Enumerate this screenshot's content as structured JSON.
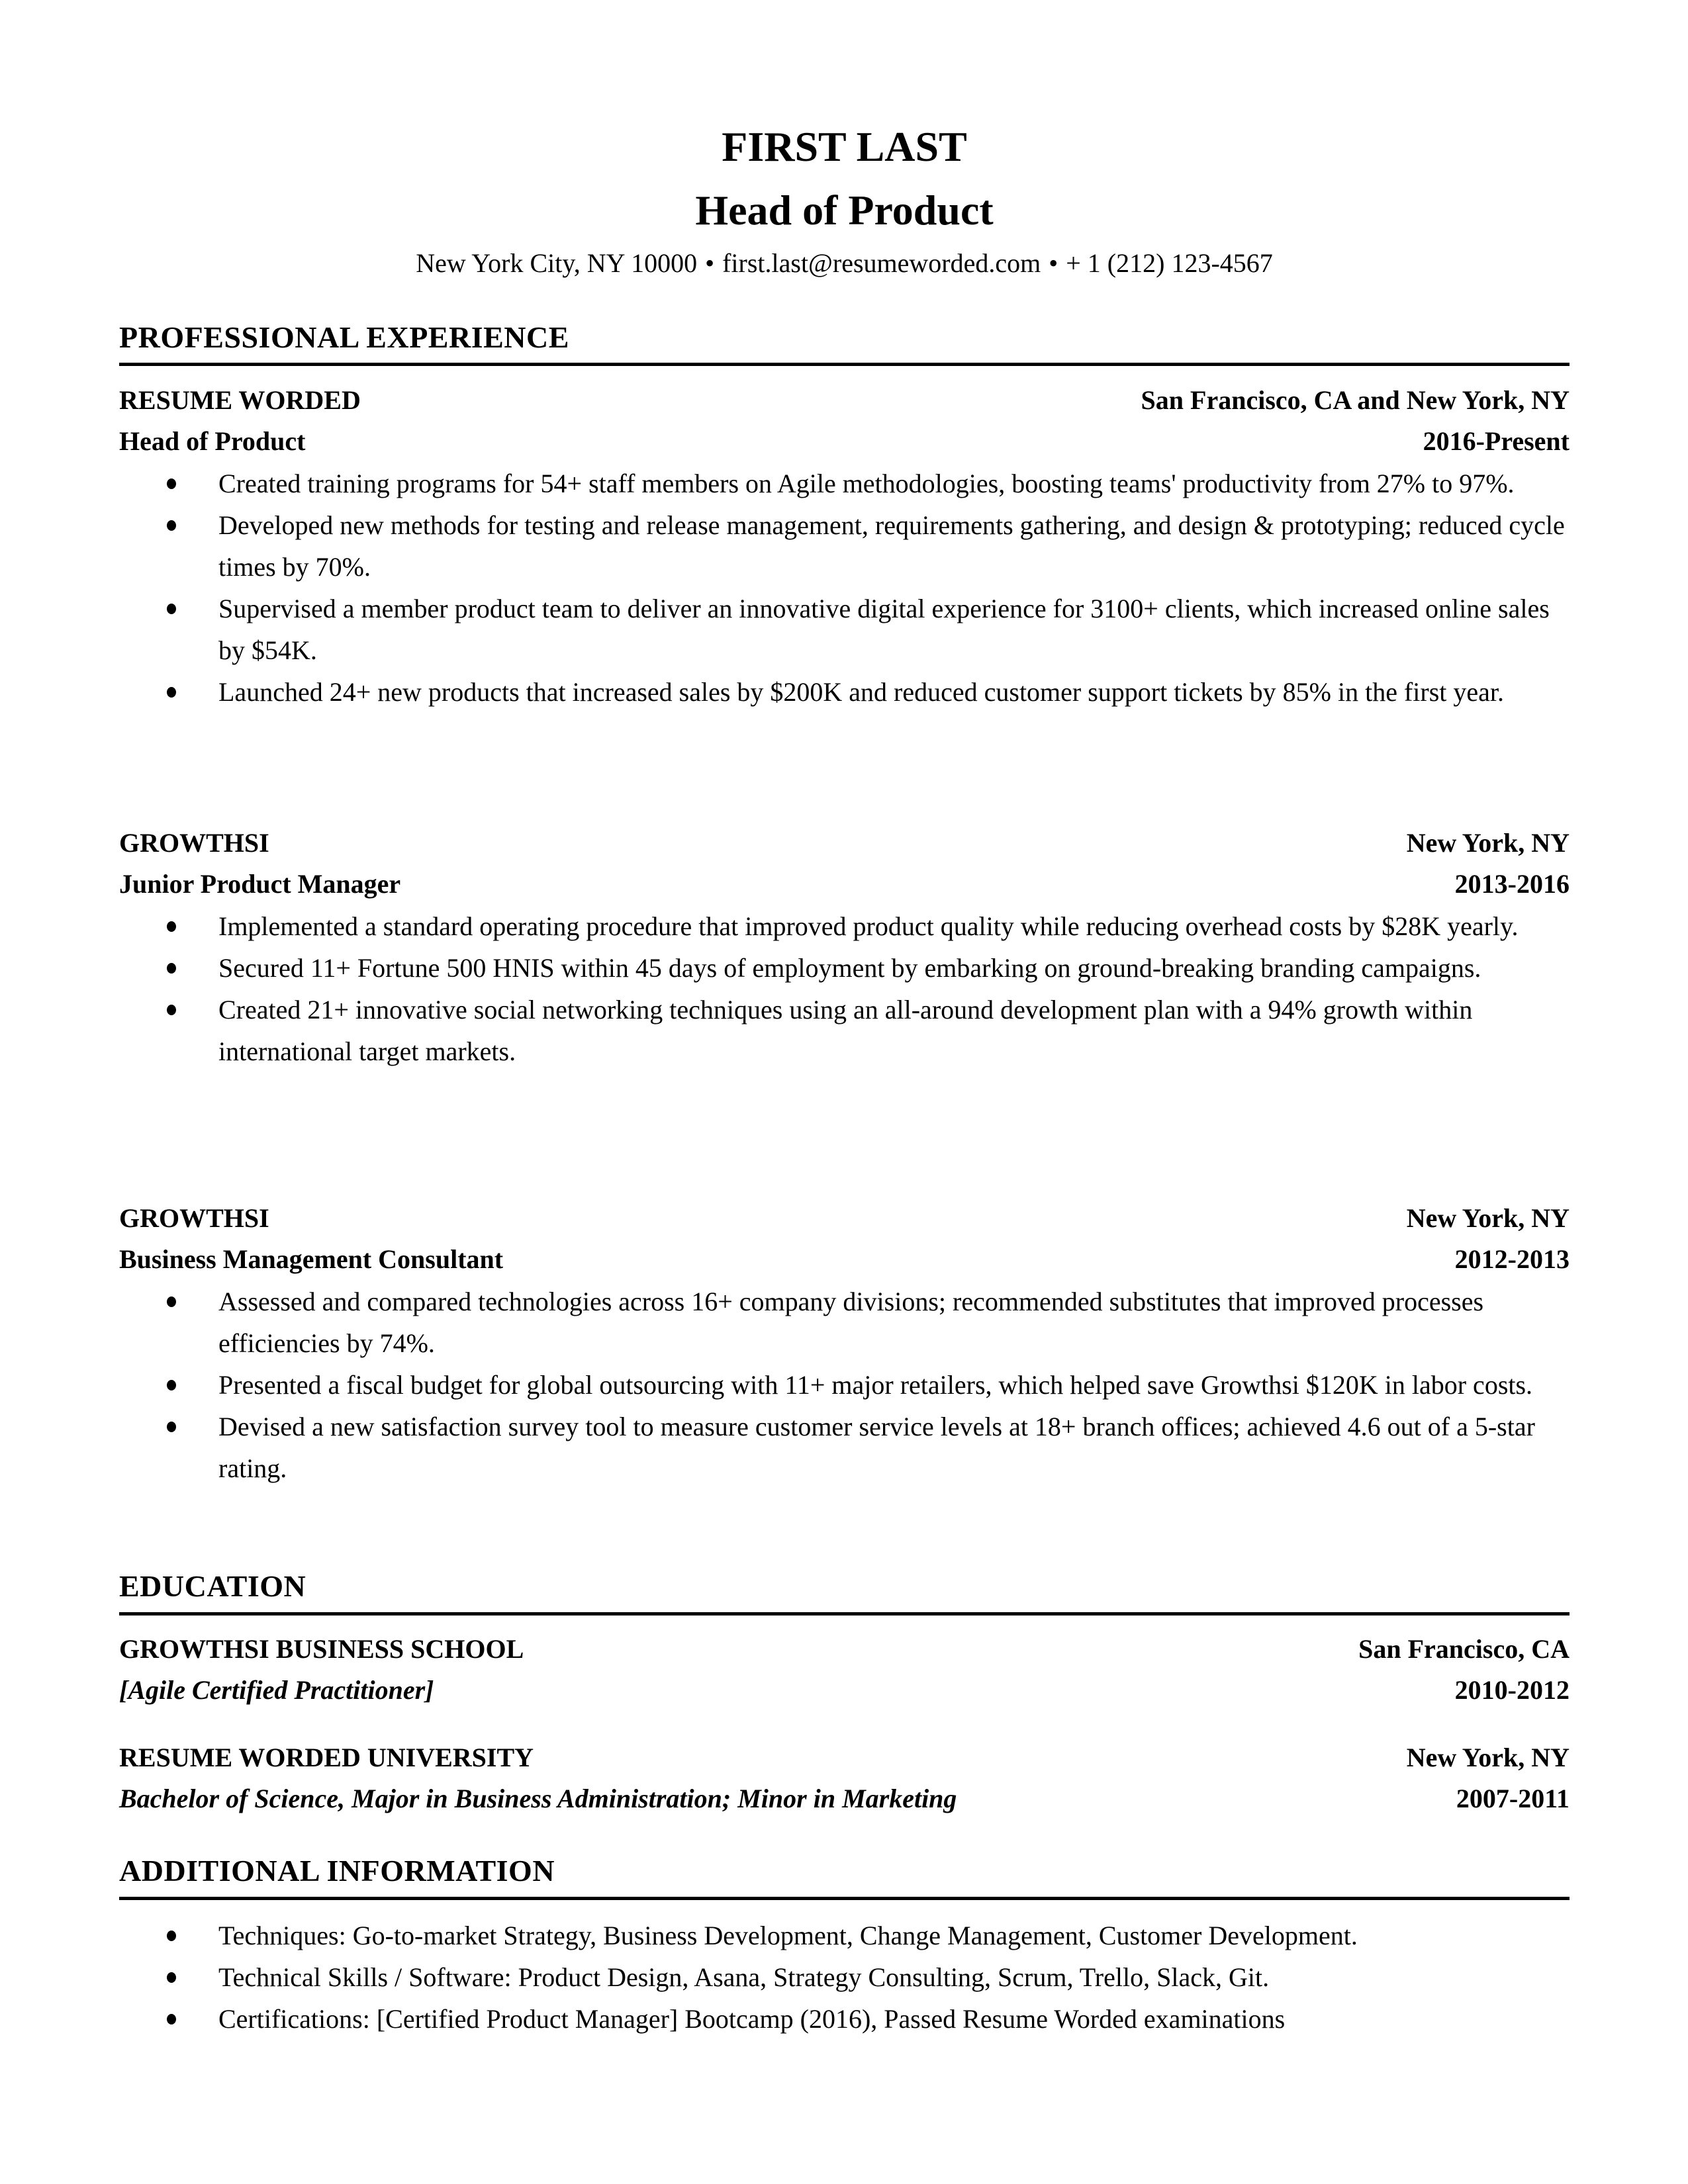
{
  "header": {
    "name": "FIRST LAST",
    "title": "Head of Product",
    "contact": {
      "location": "New York City, NY 10000",
      "separator": "•",
      "email": "first.last@resumeworded.com",
      "phone": "+ 1 (212) 123-4567"
    }
  },
  "sections": {
    "experience": {
      "heading": "PROFESSIONAL EXPERIENCE",
      "jobs": [
        {
          "company": "RESUME WORDED",
          "location": "San Francisco, CA and New York, NY",
          "role": "Head of Product",
          "dates": "2016-Present",
          "bullets": [
            "Created training programs for 54+ staff members on Agile methodologies, boosting teams' productivity from 27% to 97%.",
            "Developed new methods for testing and release management, requirements gathering, and design & prototyping; reduced cycle times by 70%.",
            "Supervised a member product team to deliver an innovative digital experience for 3100+ clients, which increased online sales by $54K.",
            "Launched 24+ new products that increased sales by $200K and reduced customer support tickets by 85% in the first year."
          ]
        },
        {
          "company": "GROWTHSI",
          "location": "New York, NY",
          "role": "Junior Product Manager",
          "dates": "2013-2016",
          "bullets": [
            "Implemented a standard operating procedure that improved product quality while reducing overhead costs by $28K yearly.",
            "Secured  11+ Fortune 500 HNIS within 45 days of employment by embarking on ground-breaking branding campaigns.",
            "Created 21+ innovative social networking techniques using an all-around development plan with a 94% growth within international target markets."
          ]
        },
        {
          "company": "GROWTHSI",
          "location": "New York, NY",
          "role": "Business Management Consultant",
          "dates": "2012-2013",
          "bullets": [
            "Assessed and compared technologies across 16+ company divisions; recommended substitutes that improved processes efficiencies by 74%.",
            "Presented a fiscal budget for global outsourcing with 11+ major retailers, which helped save Growthsi $120K in labor costs.",
            "Devised a new satisfaction survey tool to measure customer service levels at 18+ branch offices; achieved 4.6 out of a 5-star rating."
          ]
        }
      ]
    },
    "education": {
      "heading": "EDUCATION",
      "schools": [
        {
          "school": "GROWTHSI BUSINESS SCHOOL",
          "location": "San Francisco, CA",
          "degree": "[Agile Certified Practitioner]",
          "dates": "2010-2012"
        },
        {
          "school": "RESUME WORDED UNIVERSITY",
          "location": "New York, NY",
          "degree": "Bachelor of Science, Major in Business Administration; Minor in Marketing",
          "dates": "2007-2011"
        }
      ]
    },
    "additional": {
      "heading": "ADDITIONAL INFORMATION",
      "bullets": [
        "Techniques: Go-to-market Strategy, Business Development, Change Management, Customer Development.",
        "Technical Skills / Software: Product Design, Asana, Strategy Consulting, Scrum,  Trello, Slack, Git.",
        "Certifications: [Certified Product Manager] Bootcamp (2016), Passed Resume Worded examinations"
      ]
    }
  }
}
